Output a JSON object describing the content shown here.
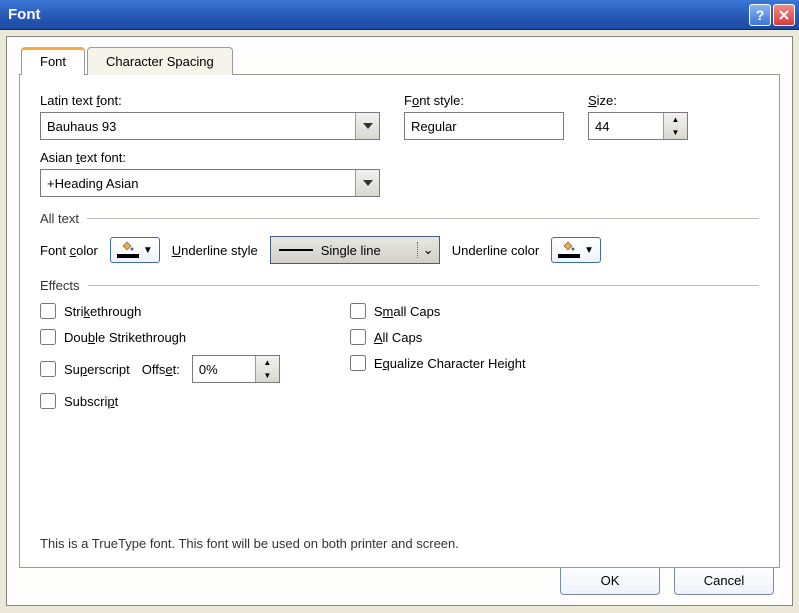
{
  "title": "Font",
  "tabs": {
    "font": "Font",
    "spacing": "Character Spacing"
  },
  "labels": {
    "latin_font": "Latin text font:",
    "font_style": "Font style:",
    "size": "Size:",
    "asian_font": "Asian text font:",
    "all_text": "All text",
    "font_color": "Font color",
    "underline_style": "Underline style",
    "underline_color": "Underline color",
    "effects": "Effects",
    "offset": "Offset:"
  },
  "values": {
    "latin_font": "Bauhaus 93",
    "font_style": "Regular",
    "size": "44",
    "asian_font": "+Heading Asian",
    "underline_style": "Single line",
    "offset": "0%"
  },
  "effects": {
    "strikethrough": "Strikethrough",
    "double_strike": "Double Strikethrough",
    "superscript": "Superscript",
    "subscript": "Subscript",
    "small_caps": "Small Caps",
    "all_caps": "All Caps",
    "equalize": "Equalize Character Height"
  },
  "info": "This is a TrueType font. This font will be used on both printer and screen.",
  "buttons": {
    "ok": "OK",
    "cancel": "Cancel"
  }
}
